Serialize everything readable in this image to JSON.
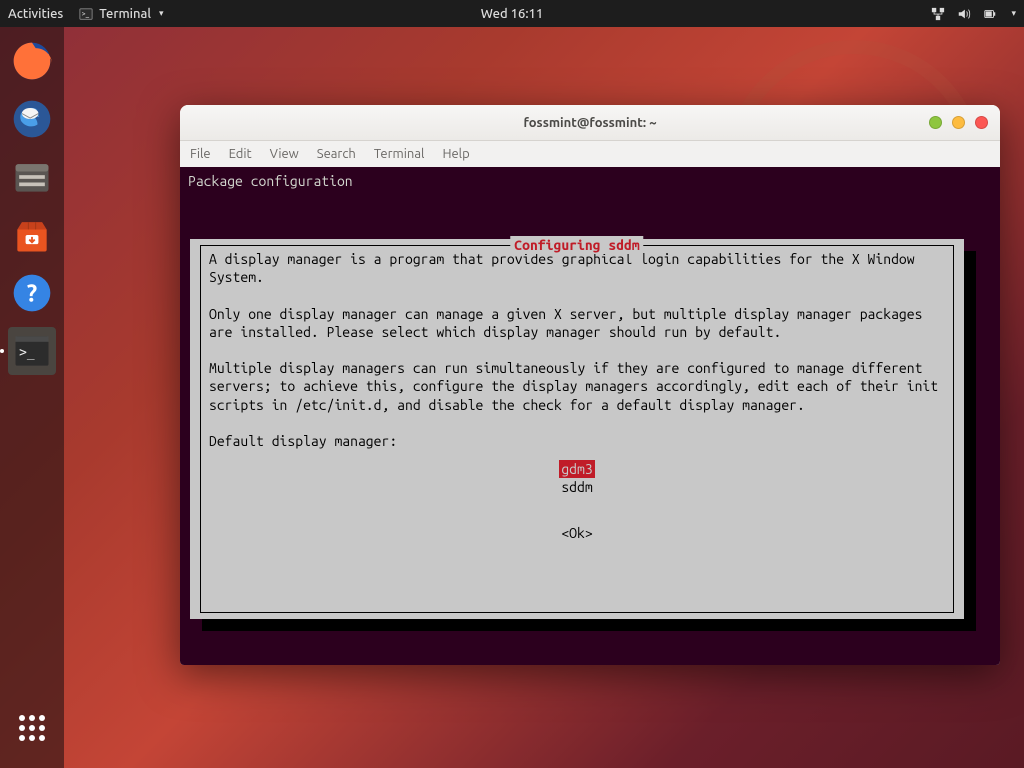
{
  "topbar": {
    "activities": "Activities",
    "terminal_label": "Terminal",
    "clock": "Wed 16:11"
  },
  "launcher": {
    "items": [
      "firefox",
      "thunderbird",
      "files",
      "software",
      "help",
      "terminal"
    ]
  },
  "window": {
    "title": "fossmint@fossmint: ~",
    "menu": {
      "file": "File",
      "edit": "Edit",
      "view": "View",
      "search": "Search",
      "terminal": "Terminal",
      "help": "Help"
    }
  },
  "terminal": {
    "header": "Package configuration"
  },
  "dialog": {
    "title": "Configuring sddm",
    "para1": "A display manager is a program that provides graphical login capabilities for the X Window System.",
    "para2": "Only one display manager can manage a given X server, but multiple display manager packages are installed. Please select which display manager should run by default.",
    "para3": "Multiple display managers can run simultaneously if they are configured to manage different servers; to achieve this, configure the display managers accordingly, edit each of their init scripts in /etc/init.d, and disable the check for a default display manager.",
    "prompt": "Default display manager:",
    "options": {
      "opt1": "gdm3",
      "opt2": "sddm"
    },
    "ok": "<Ok>"
  }
}
